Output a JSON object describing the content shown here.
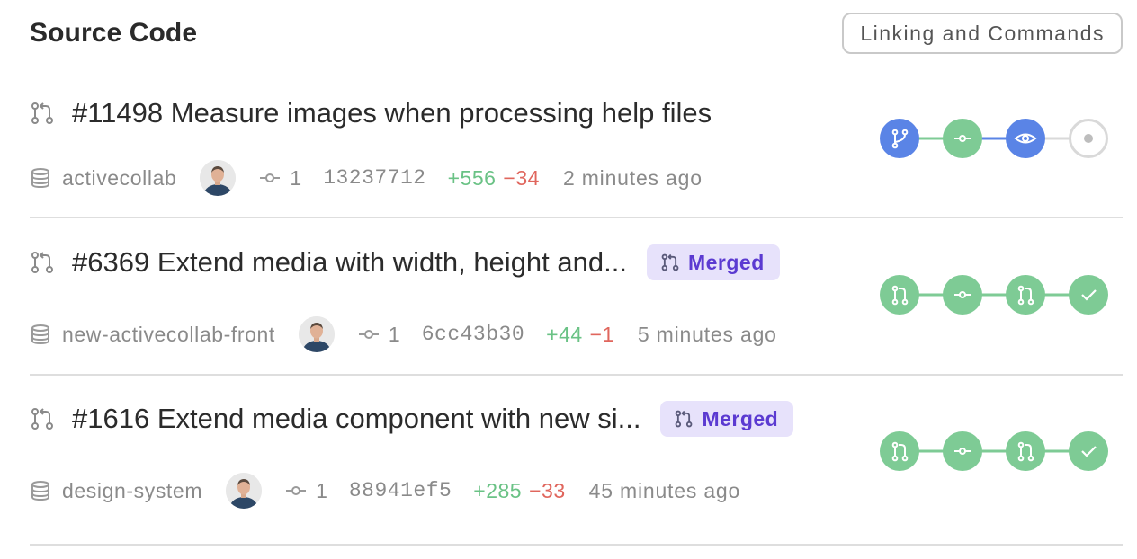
{
  "header": {
    "title": "Source Code",
    "link_button": "Linking and Commands"
  },
  "colors": {
    "blue": "#5a84e6",
    "green": "#7ecb95",
    "grey": "#d9d9d9",
    "badge_bg": "#e7e2fb",
    "badge_text": "#5b3ad1",
    "additions": "#6ac285",
    "deletions": "#e0665d"
  },
  "pull_requests": [
    {
      "title": "#11498 Measure images when processing help files",
      "badge": "",
      "repo": "activecollab",
      "commits": "1",
      "sha": "13237712",
      "additions": "+556",
      "deletions": "−34",
      "time": "2 minutes ago",
      "pipeline": [
        {
          "icon": "branch-icon",
          "state": "blue"
        },
        {
          "icon": "commit-icon",
          "state": "green"
        },
        {
          "icon": "eye-icon",
          "state": "blue"
        },
        {
          "icon": "dot-icon",
          "state": "pending"
        }
      ]
    },
    {
      "title": "#6369 Extend media with width, height and...",
      "badge": "Merged",
      "repo": "new-activecollab-front",
      "commits": "1",
      "sha": "6cc43b30",
      "additions": "+44",
      "deletions": "−1",
      "time": "5 minutes ago",
      "pipeline": [
        {
          "icon": "pull-request-icon",
          "state": "green"
        },
        {
          "icon": "commit-icon",
          "state": "green"
        },
        {
          "icon": "pull-request-icon",
          "state": "green"
        },
        {
          "icon": "check-icon",
          "state": "green"
        }
      ]
    },
    {
      "title": "#1616 Extend media component with new si...",
      "badge": "Merged",
      "repo": "design-system",
      "commits": "1",
      "sha": "88941ef5",
      "additions": "+285",
      "deletions": "−33",
      "time": "45 minutes ago",
      "pipeline": [
        {
          "icon": "pull-request-icon",
          "state": "green"
        },
        {
          "icon": "commit-icon",
          "state": "green"
        },
        {
          "icon": "pull-request-icon",
          "state": "green"
        },
        {
          "icon": "check-icon",
          "state": "green"
        }
      ]
    }
  ]
}
